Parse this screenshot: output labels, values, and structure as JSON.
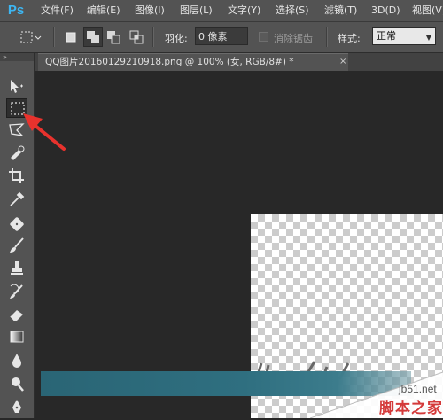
{
  "app": {
    "logo": "Ps"
  },
  "menubar": {
    "items": [
      "文件(F)",
      "编辑(E)",
      "图像(I)",
      "图层(L)",
      "文字(Y)",
      "选择(S)",
      "滤镜(T)",
      "3D(D)",
      "视图(V)"
    ]
  },
  "options": {
    "feather_label": "羽化:",
    "feather_value": "0 像素",
    "antialias_label": "消除锯齿",
    "style_label": "样式:",
    "style_value": "正常"
  },
  "toolbar": {
    "collapse_glyph": "»",
    "tools": [
      "move-tool",
      "rectangular-marquee-tool",
      "polygonal-lasso-tool",
      "quick-selection-tool",
      "crop-tool",
      "eyedropper-tool",
      "healing-brush-tool",
      "brush-tool",
      "clone-stamp-tool",
      "history-brush-tool",
      "eraser-tool",
      "gradient-tool",
      "blur-tool",
      "dodge-tool",
      "pen-tool"
    ],
    "active_tool": "rectangular-marquee-tool"
  },
  "document": {
    "tab_title": "QQ图片20160129210918.png @ 100% (女, RGB/8#) *",
    "close_glyph": "×"
  },
  "watermark": {
    "url": "jb51.net",
    "site_name": "脚本之家"
  },
  "colors": {
    "accent_blue": "#3db6f2",
    "arrow_red": "#e8322d",
    "panel": "#535353",
    "canvas_bg": "#282828"
  }
}
